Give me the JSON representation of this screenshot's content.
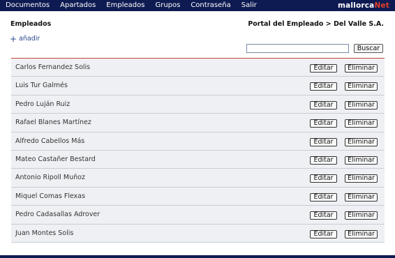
{
  "nav": {
    "items": [
      "Documentos",
      "Apartados",
      "Empleados",
      "Grupos",
      "Contraseña",
      "Salir"
    ],
    "brand_main": "mallorca",
    "brand_accent": "Net"
  },
  "header": {
    "title": "Empleados",
    "breadcrumb": "Portal del Empleado > Del Valle S.A."
  },
  "actions": {
    "add_label": "añadir",
    "search_placeholder": "",
    "search_button": "Buscar"
  },
  "employees": {
    "edit_label": "Editar",
    "delete_label": "Eliminar",
    "rows": [
      "Carlos Fernandez Solis",
      "Luis Tur Galmés",
      "Pedro Luján Ruiz",
      "Rafael Blanes Martínez",
      "Alfredo Cabellos Más",
      "Mateo Castañer Bestard",
      "Antonio Ripoll Muñoz",
      "Miquel Comas Flexas",
      "Pedro Cadasallas Adrover",
      "Juan Montes Solis"
    ]
  },
  "colors": {
    "nav_bg": "#0e1b52",
    "brand_accent": "#e0402a",
    "list_top_border": "#c8443e",
    "row_bg": "#eef0f3"
  }
}
